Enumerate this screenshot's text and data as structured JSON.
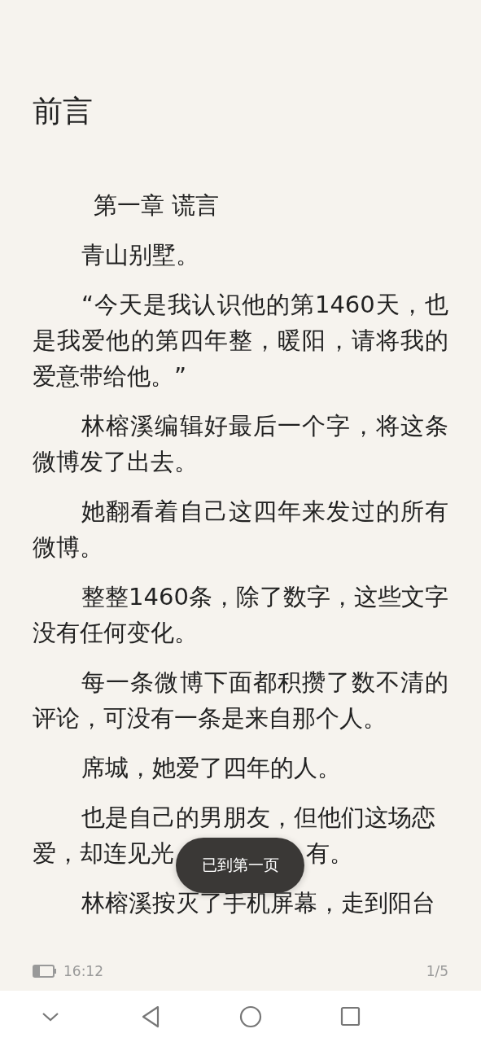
{
  "title": "前言",
  "paragraphs": [
    {
      "kind": "heading",
      "text": "第一章 谎言"
    },
    {
      "kind": "body",
      "text": "青山别墅。"
    },
    {
      "kind": "body",
      "text": "“今天是我认识他的第1460天，也是我爱他的第四年整，暖阳，请将我的爱意带给他。”"
    },
    {
      "kind": "body",
      "text": "林榕溪编辑好最后一个字，将这条微博发了出去。"
    },
    {
      "kind": "body",
      "text": "她翻看着自己这四年来发过的所有微博。"
    },
    {
      "kind": "body",
      "text": "整整1460条，除了数字，这些文字没有任何变化。"
    },
    {
      "kind": "body",
      "text": "每一条微博下面都积攒了数不清的评论，可没有一条是来自那个人。"
    },
    {
      "kind": "body",
      "text": "席城，她爱了四年的人。"
    },
    {
      "kind": "split",
      "text": "也是自己的男朋友，但他们这场恋",
      "text_before_toast": "爱，却连见光",
      "text_after_toast": "有。"
    },
    {
      "kind": "body",
      "text": "林榕溪按灭了手机屏幕，走到阳台"
    }
  ],
  "toast": "已到第一页",
  "footer": {
    "time": "16:12",
    "page": "1/5"
  },
  "nav_buttons": [
    {
      "kind": "collapse"
    },
    {
      "kind": "back"
    },
    {
      "kind": "home"
    },
    {
      "kind": "recents"
    }
  ]
}
